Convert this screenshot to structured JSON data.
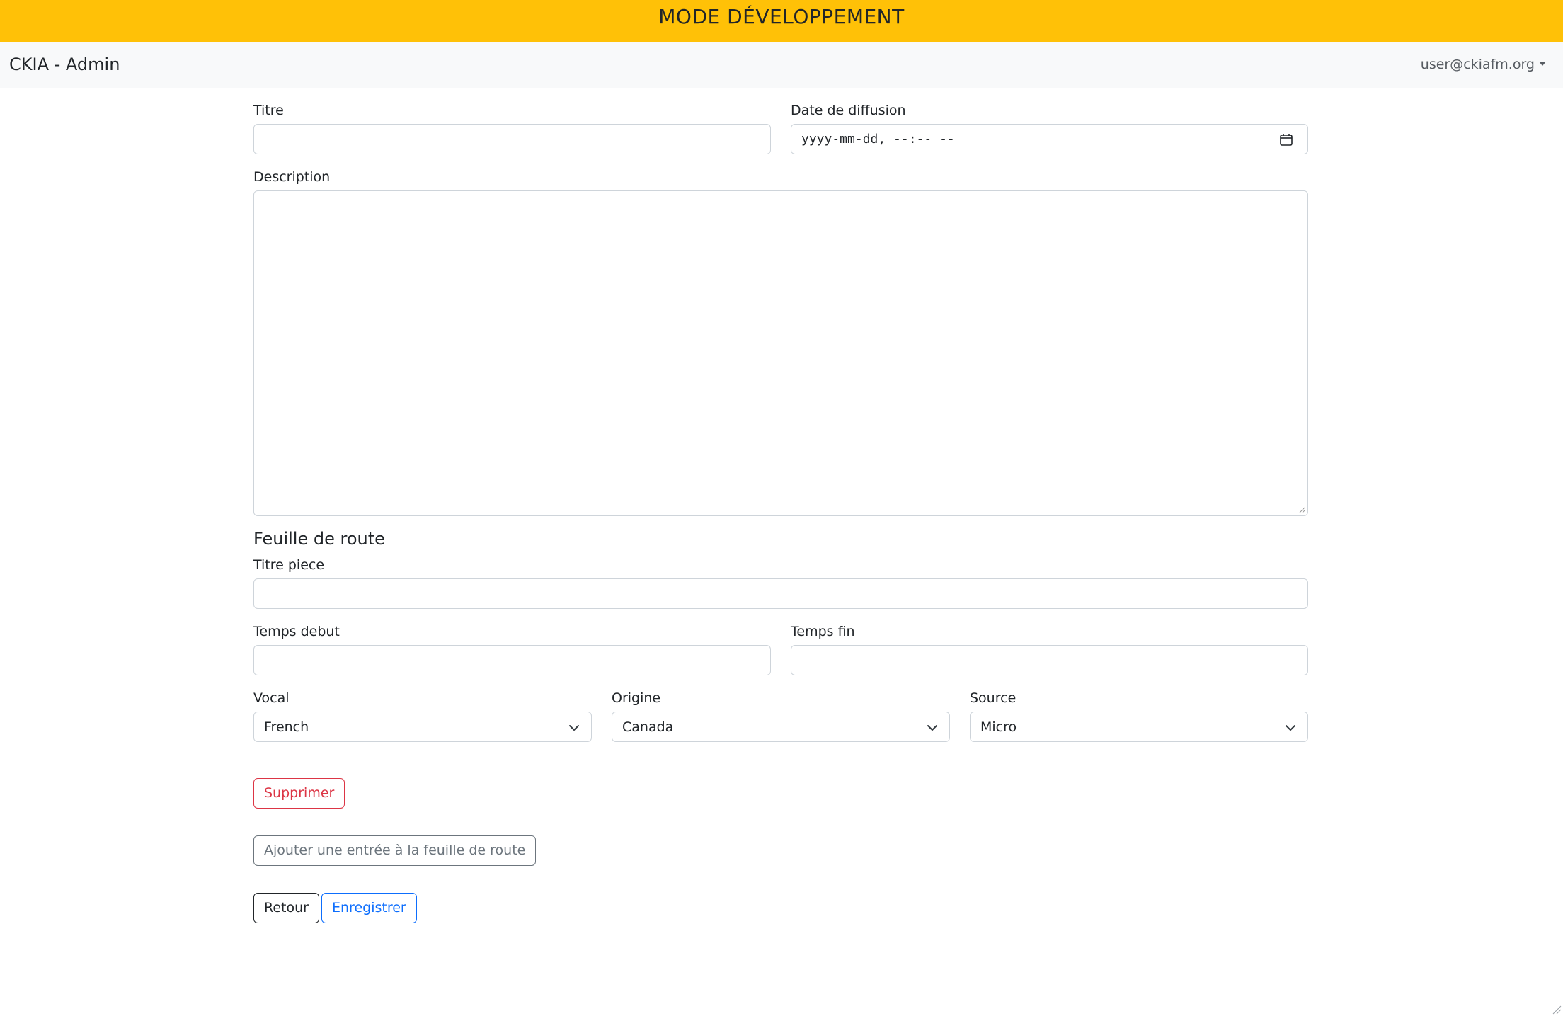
{
  "banner": {
    "text": "MODE DÉVELOPPEMENT"
  },
  "navbar": {
    "brand": "CKIA - Admin",
    "user": "user@ckiafm.org"
  },
  "form": {
    "titre": {
      "label": "Titre",
      "value": ""
    },
    "date_diffusion": {
      "label": "Date de diffusion",
      "display": "yyyy-mm-dd, --:-- --"
    },
    "description": {
      "label": "Description",
      "value": ""
    }
  },
  "feuille_de_route": {
    "heading": "Feuille de route",
    "titre_piece": {
      "label": "Titre piece",
      "value": ""
    },
    "temps_debut": {
      "label": "Temps debut",
      "value": ""
    },
    "temps_fin": {
      "label": "Temps fin",
      "value": ""
    },
    "vocal": {
      "label": "Vocal",
      "selected": "French"
    },
    "origine": {
      "label": "Origine",
      "selected": "Canada"
    },
    "source": {
      "label": "Source",
      "selected": "Micro"
    },
    "supprimer_label": "Supprimer"
  },
  "actions": {
    "ajouter_label": "Ajouter une entrée à la feuille de route",
    "retour_label": "Retour",
    "enregistrer_label": "Enregistrer"
  },
  "colors": {
    "banner": "#ffc107",
    "navbar": "#f8f9fa",
    "danger": "#dc3545",
    "primary": "#0d6efd",
    "secondary": "#6c757d"
  }
}
